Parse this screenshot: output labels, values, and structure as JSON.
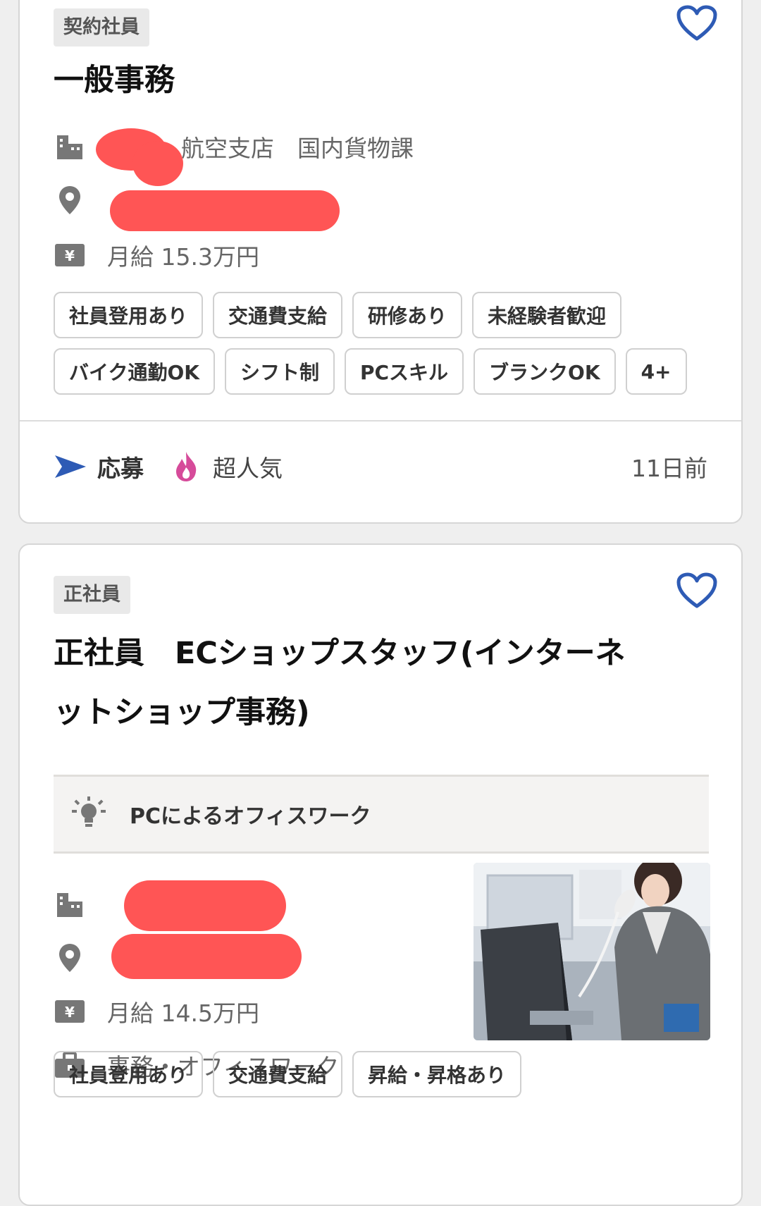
{
  "cards": [
    {
      "employment_type": "契約社員",
      "title": "一般事務",
      "company_suffix": "航空支店　国内貨物課",
      "salary": "月給 15.3万円",
      "tags": [
        "社員登用あり",
        "交通費支給",
        "研修あり",
        "未経験者歓迎",
        "バイク通勤OK",
        "シフト制",
        "PCスキル",
        "ブランクOK",
        "4+"
      ],
      "apply_label": "応募",
      "popularity": "超人気",
      "posted": "11日前"
    },
    {
      "employment_type": "正社員",
      "title": "正社員　ECショップスタッフ(インターネットショップ事務)",
      "feature": "PCによるオフィスワーク",
      "salary": "月給 14.5万円",
      "job_category": "事務・オフィスワーク",
      "tags": [
        "社員登用あり",
        "交通費支給",
        "昇給・昇格あり"
      ]
    }
  ],
  "icons": {
    "favorite": "heart-outline-icon",
    "company": "building-icon",
    "location": "location-pin-icon",
    "salary": "yen-icon",
    "apply": "send-arrow-icon",
    "popularity": "flame-icon",
    "feature": "lightbulb-icon",
    "category": "briefcase-icon"
  },
  "colors": {
    "accent_blue": "#2e5bb5",
    "flame_pink": "#d64b9a",
    "redaction": "#ff5555"
  }
}
